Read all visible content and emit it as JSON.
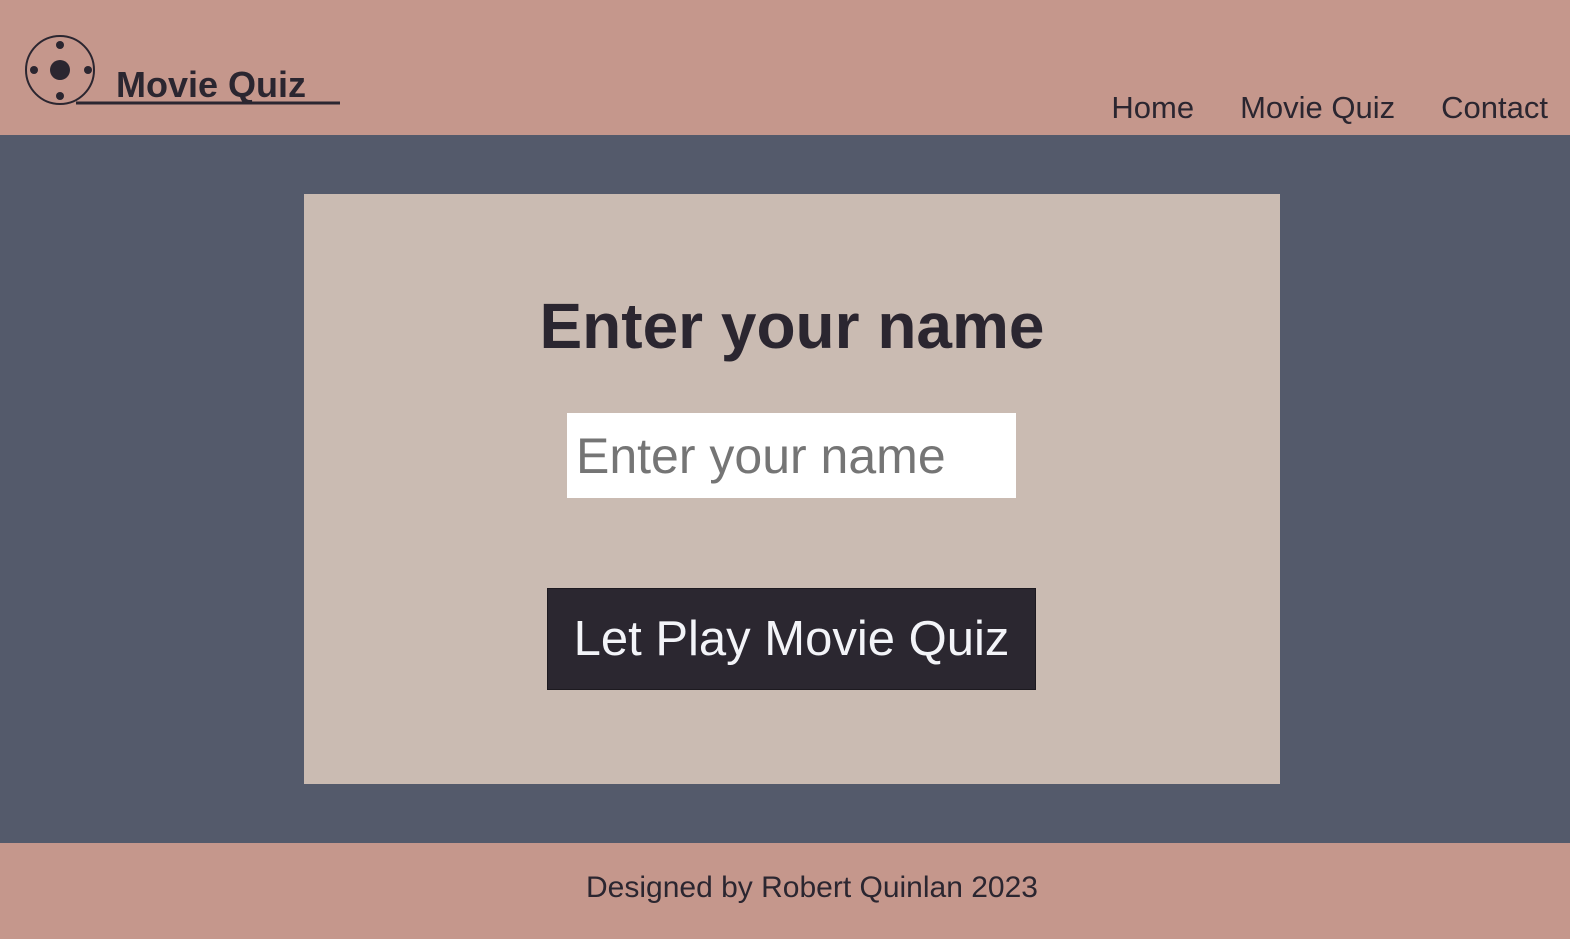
{
  "header": {
    "logo_text": "Movie Quiz",
    "logo_icon": "film-reel-icon",
    "nav": [
      {
        "label": "Home"
      },
      {
        "label": "Movie Quiz"
      },
      {
        "label": "Contact"
      }
    ]
  },
  "card": {
    "title": "Enter your name",
    "input_placeholder": "Enter your name",
    "input_value": "",
    "button_label": "Let Play Movie Quiz"
  },
  "footer": {
    "text": "Designed by Robert Quinlan 2023"
  },
  "colors": {
    "header_bg": "#c5978c",
    "page_bg": "#545a6b",
    "card_bg": "#cabbb2",
    "button_bg": "#2b2730",
    "text": "#2b2630"
  }
}
